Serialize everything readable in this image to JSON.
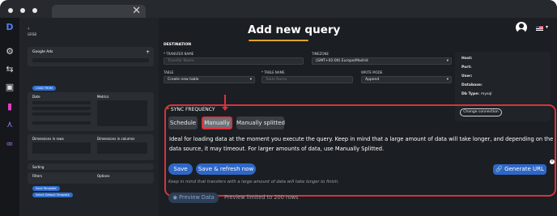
{
  "header": {
    "title": "Add new query",
    "accent_color": "#e0a426"
  },
  "destination": {
    "section": "DESTINATION",
    "transfer_name_label": "TRANSFER NAME",
    "transfer_name_placeholder": "Transfer Name",
    "timezone_label": "TIMEZONE",
    "timezone_value": "(GMT+02:00) Europe/Madrid",
    "table_label": "TABLE",
    "table_value": "Create new table",
    "table_name_label": "TABLE NAME",
    "table_name_placeholder": "Table Name",
    "write_mode_label": "WRITE MODE",
    "write_mode_value": "Append"
  },
  "connection": {
    "host_label": "Host:",
    "port_label": "Port:",
    "user_label": "User:",
    "database_label": "Database:",
    "db_type_label": "Db Type:",
    "db_type_value": "mysql",
    "change_button": "Change connection"
  },
  "sync": {
    "label": "SYNC FREQUENCY",
    "options": [
      "Schedule",
      "Manually",
      "Manually splitted"
    ],
    "selected": "Manually",
    "description": "Ideal for loading data at the moment you execute the query. Keep in mind that a large amount of data will take longer, and depending on the data source, it may timeout. For larger amounts of data, use Manually Splitted.",
    "highlight_color": "#d9323d"
  },
  "actions": {
    "save": "Save",
    "save_refresh": "Save & refresh now",
    "generate_url": "Generate URL",
    "hint": "Keep in mind that transfers with a large amount of data will take longer to finish.",
    "preview": "Preview Data",
    "preview_note": "Preview limited to 200 rows"
  },
  "left_panel": {
    "source_name": "Google Ads",
    "date_label": "Date",
    "metrics_label": "Metrics",
    "dimensions_rows_label": "Dimensions in rows",
    "dimensions_cols_label": "Dimensions in columns",
    "sorting_label": "Sorting",
    "filters_label": "Filters",
    "options_label": "Options",
    "add_template": "Save Template",
    "apply_template": "Select Default Template"
  }
}
